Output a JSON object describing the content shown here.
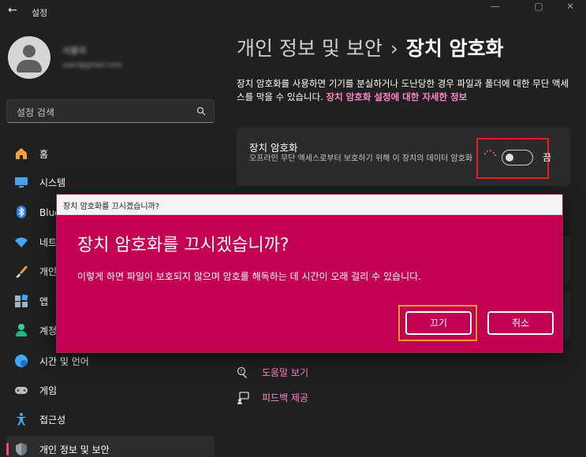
{
  "window": {
    "title": "설정",
    "back_glyph": "←",
    "minimize_glyph": "—",
    "maximize_glyph": "▢",
    "close_glyph": "✕"
  },
  "user": {
    "name": "사용자",
    "email": "user@gmail.com"
  },
  "search": {
    "placeholder": "설정 검색"
  },
  "sidebar": {
    "items": [
      {
        "label": "홈",
        "icon": "home-icon"
      },
      {
        "label": "시스템",
        "icon": "system-icon"
      },
      {
        "label": "Bluetooth 및 장치",
        "icon": "bluetooth-icon"
      },
      {
        "label": "네트워크 및 인터넷",
        "icon": "wifi-icon"
      },
      {
        "label": "개인 설정",
        "icon": "brush-icon"
      },
      {
        "label": "앱",
        "icon": "apps-icon"
      },
      {
        "label": "계정",
        "icon": "account-icon"
      },
      {
        "label": "시간 및 언어",
        "icon": "globe-icon"
      },
      {
        "label": "게임",
        "icon": "gamepad-icon"
      },
      {
        "label": "접근성",
        "icon": "accessibility-icon"
      },
      {
        "label": "개인 정보 및 보안",
        "icon": "shield-icon"
      }
    ],
    "active_index": 10,
    "accent_color": "#ff3d9a"
  },
  "main": {
    "breadcrumb_parent": "개인 정보 및 보안",
    "breadcrumb_sep": "›",
    "breadcrumb_current": "장치 암호화",
    "description": "장치 암호화를 사용하면 기기를 분실하거나 도난당한 경우 파일과 폴더에 대한 무단 액세스를 막을 수 있습니다.",
    "description_link": "장치 암호화 설정에 대한 자세한 정보",
    "setting": {
      "title": "장치 암호화",
      "subtitle": "오프라인 무단 액세스로부터 보호하기 위해 이 장치의 데이터 암호화",
      "state_label": "끔",
      "toggle_on": false
    },
    "related": [
      {
        "label": "도움말 보기",
        "icon": "help-icon"
      },
      {
        "label": "피드백 제공",
        "icon": "feedback-icon"
      }
    ]
  },
  "dialog": {
    "titlebar": "장치 암호화를 끄시겠습니까?",
    "heading": "장치 암호화를 끄시겠습니까?",
    "message": "이렇게 하면 파일이 보호되지 않으며 암호를 해독하는 데 시간이 오래 걸리 수 있습니다.",
    "confirm_label": "끄기",
    "cancel_label": "취소",
    "background_color": "#c30052"
  },
  "colors": {
    "window_bg": "#202020",
    "card_bg": "#2b2b2b",
    "link": "#ff84c9",
    "highlight_red": "#e4201e",
    "highlight_orange": "#f0a21c"
  }
}
